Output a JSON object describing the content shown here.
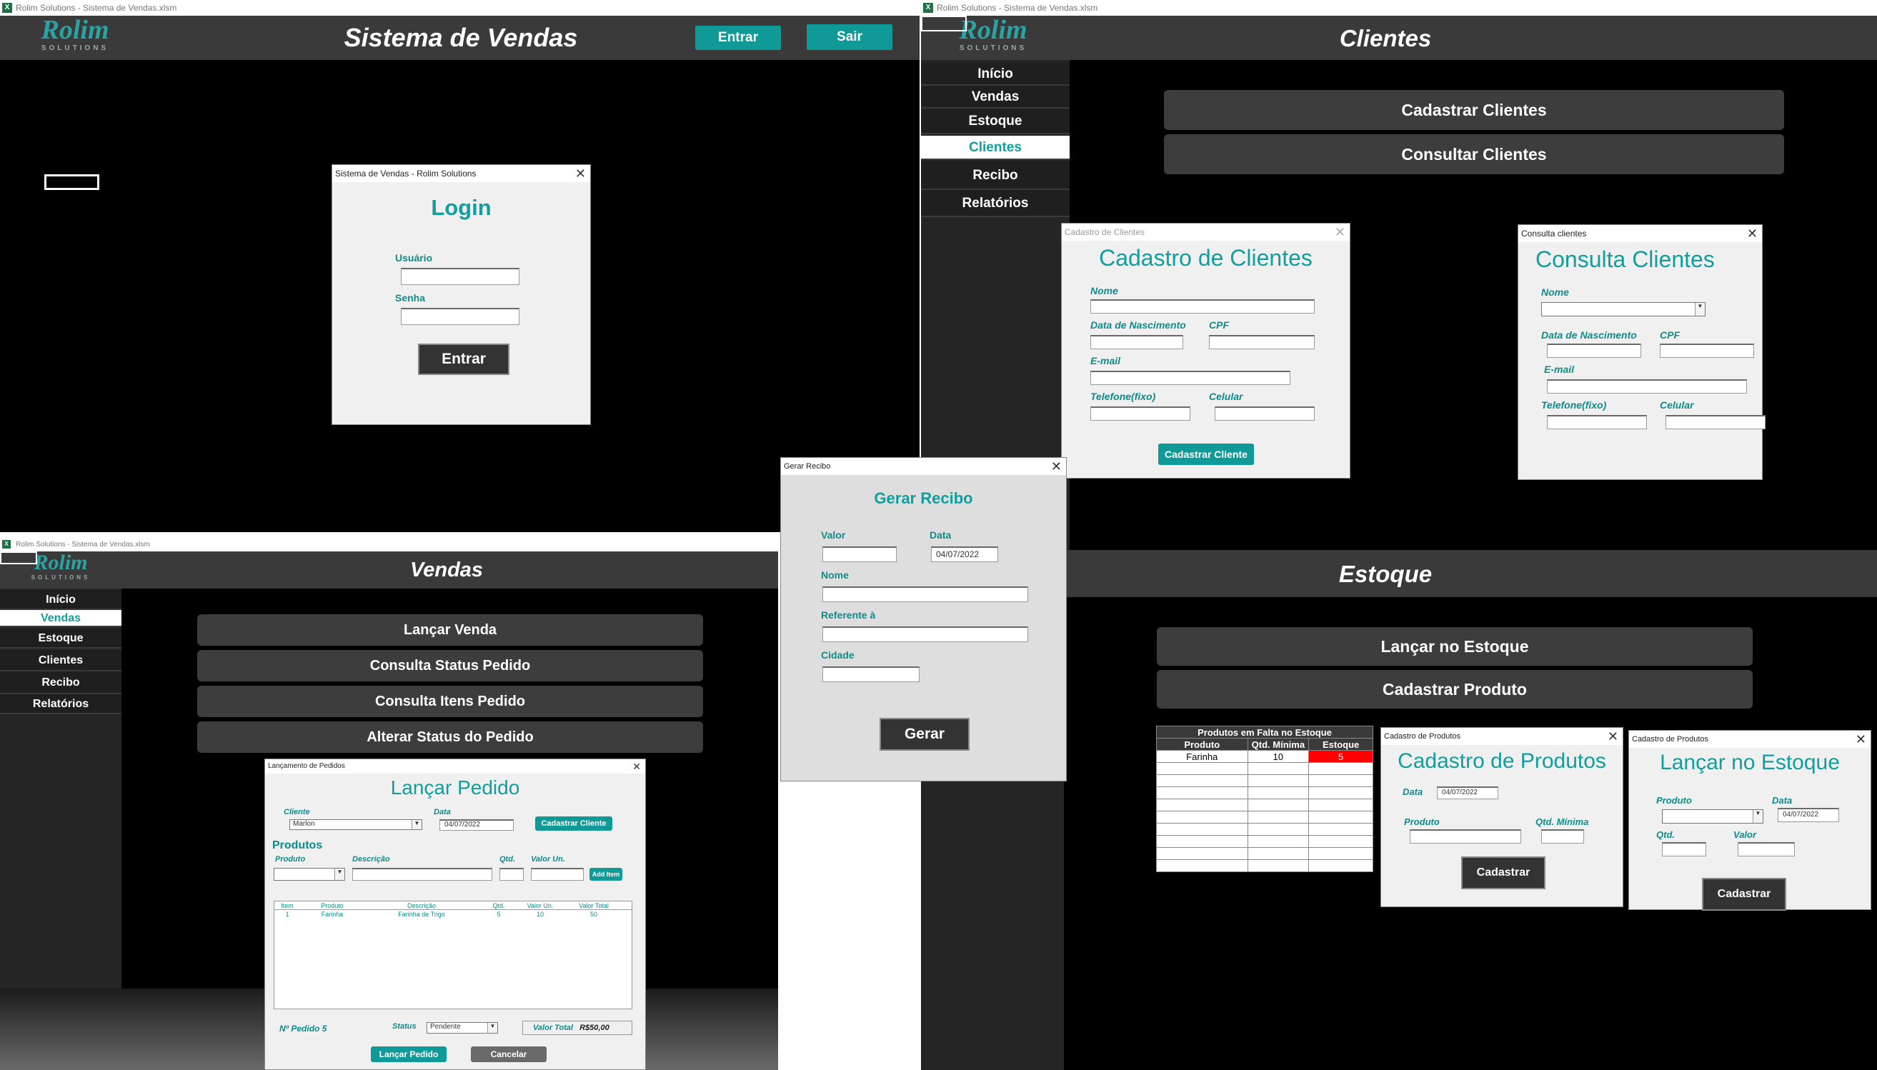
{
  "app_title": "Rolim Solutions - Sistema de Vendas.xlsm",
  "logo": {
    "name": "Rolim",
    "tagline": "SOLUTIONS"
  },
  "main_window": {
    "title": "Sistema de Vendas",
    "enter_label": "Entrar",
    "exit_label": "Sair",
    "login_dialog": {
      "title": "Sistema de Vendas - Rolim Solutions",
      "heading": "Login",
      "user_label": "Usuário",
      "password_label": "Senha",
      "submit_label": "Entrar"
    }
  },
  "sidebar_items": [
    "Início",
    "Vendas",
    "Estoque",
    "Clientes",
    "Recibo",
    "Relatórios"
  ],
  "clientes_window": {
    "title": "Clientes",
    "buttons": [
      "Cadastrar Clientes",
      "Consultar Clientes"
    ],
    "cadastro_dialog": {
      "title": "Cadastro de Clientes",
      "heading": "Cadastro de Clientes",
      "name_label": "Nome",
      "birth_label": "Data de Nascimento",
      "cpf_label": "CPF",
      "email_label": "E-mail",
      "phone_label": "Telefone(fixo)",
      "mobile_label": "Celular",
      "submit_label": "Cadastrar Cliente"
    },
    "consulta_dialog": {
      "title": "Consulta clientes",
      "heading": "Consulta Clientes",
      "name_label": "Nome",
      "birth_label": "Data de Nascimento",
      "cpf_label": "CPF",
      "email_label": "E-mail",
      "phone_label": "Telefone(fixo)",
      "mobile_label": "Celular"
    }
  },
  "recibo_dialog": {
    "title": "Gerar Recibo",
    "heading": "Gerar Recibo",
    "value_label": "Valor",
    "date_label": "Data",
    "date_value": "04/07/2022",
    "name_label": "Nome",
    "reference_label": "Referente à",
    "city_label": "Cidade",
    "submit_label": "Gerar"
  },
  "vendas_window": {
    "title": "Vendas",
    "buttons": [
      "Lançar Venda",
      "Consulta Status Pedido",
      "Consulta Itens Pedido",
      "Alterar Status do Pedido"
    ],
    "pedido_dialog": {
      "title": "Lançamento de Pedidos",
      "heading": "Lançar Pedido",
      "client_label": "Cliente",
      "client_value": "Marlon",
      "date_label": "Data",
      "date_value": "04/07/2022",
      "register_client_label": "Cadastrar Cliente",
      "products_heading": "Produtos",
      "product_label": "Produto",
      "description_label": "Descrição",
      "qty_label": "Qtd.",
      "unit_value_label": "Valor Un.",
      "add_item_label": "Add Item",
      "table_headers": [
        "Item",
        "Produto",
        "Descrição",
        "Qtd.",
        "Valor Un.",
        "Valor Total"
      ],
      "table_row": [
        "1",
        "Farinha",
        "Farinha de Trigo",
        "5",
        "10",
        "50"
      ],
      "order_number": "Nº Pedido 5",
      "status_label": "Status",
      "status_value": "Pendente",
      "total_label": "Valor Total",
      "total_value": "R$50,00",
      "submit_label": "Lançar Pedido",
      "cancel_label": "Cancelar"
    }
  },
  "estoque_window": {
    "title": "Estoque",
    "buttons": [
      "Lançar no Estoque",
      "Cadastrar Produto"
    ],
    "shortage_table": {
      "title": "Produtos em Falta no Estoque",
      "headers": [
        "Produto",
        "Qtd. Mínima",
        "Estoque"
      ],
      "row": [
        "Farinha",
        "10",
        "5"
      ],
      "alert_color": "#ff0000"
    },
    "cadastro_produtos_dialog": {
      "title": "Cadastro de Produtos",
      "heading": "Cadastro de Produtos",
      "date_label": "Data",
      "date_value": "04/07/2022",
      "product_label": "Produto",
      "min_qty_label": "Qtd. Mínima",
      "submit_label": "Cadastrar"
    },
    "lancar_estoque_dialog": {
      "title": "Cadastro de Produtos",
      "heading": "Lançar no Estoque",
      "product_label": "Produto",
      "date_label": "Data",
      "date_value": "04/07/2022",
      "qty_label": "Qtd.",
      "value_label": "Valor",
      "submit_label": "Cadastrar"
    }
  },
  "colors": {
    "accent": "#119e9c",
    "header": "#3a3a3a",
    "background": "#000000"
  }
}
